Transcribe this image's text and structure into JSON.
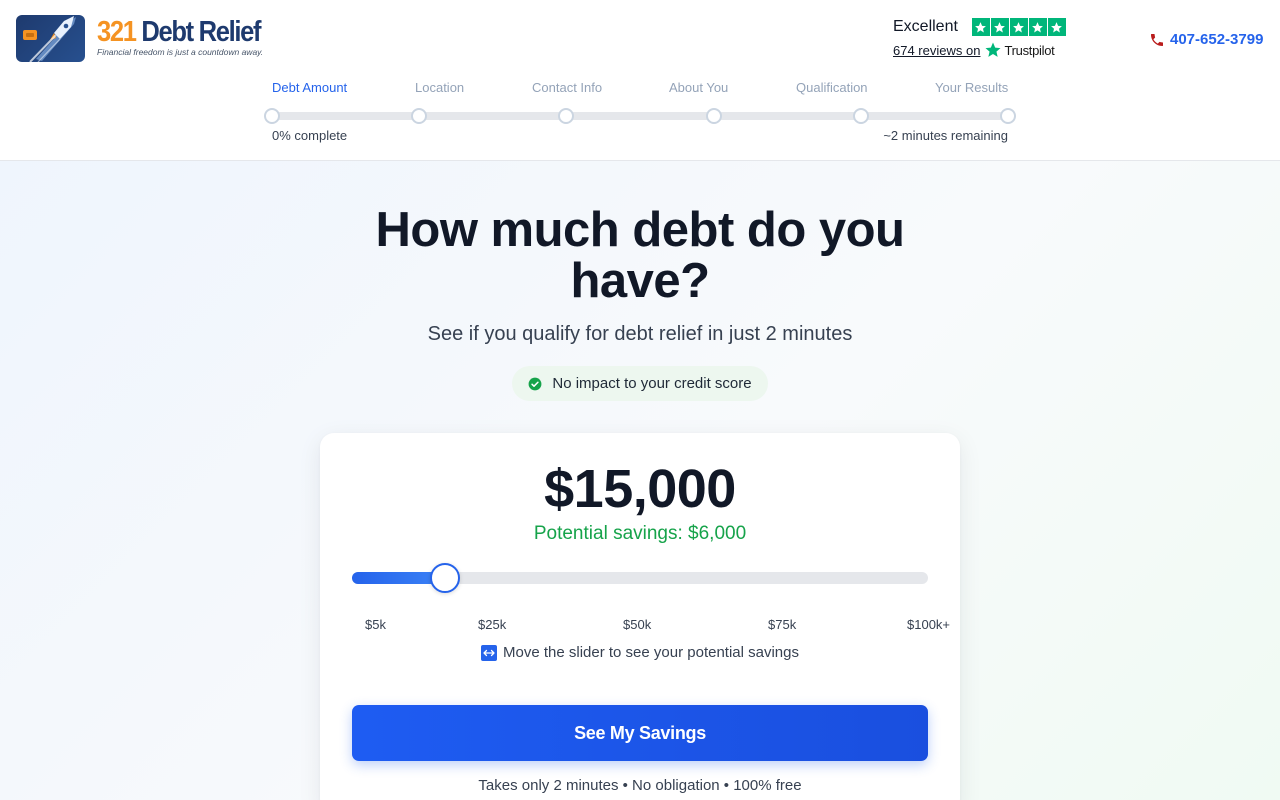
{
  "brand": {
    "name_number": "321",
    "name_words": "Debt Relief",
    "tagline": "Financial freedom is just a countdown away."
  },
  "trustpilot": {
    "rating_text": "Excellent",
    "stars": 5,
    "reviews_text": "674 reviews on",
    "platform": "Trustpilot",
    "color": "#00b67a"
  },
  "phone": {
    "number": "407-652-3799",
    "icon": "phone-icon"
  },
  "steps": {
    "items": [
      {
        "label": "Debt Amount",
        "active": true
      },
      {
        "label": "Location",
        "active": false
      },
      {
        "label": "Contact Info",
        "active": false
      },
      {
        "label": "About You",
        "active": false
      },
      {
        "label": "Qualification",
        "active": false
      },
      {
        "label": "Your Results",
        "active": false
      }
    ],
    "progress_percent": 0,
    "complete_text": "0% complete",
    "remaining_text": "~2 minutes remaining"
  },
  "hero": {
    "headline": "How much debt do you have?",
    "subheadline": "See if you qualify for debt relief in just 2 minutes",
    "badge_text": "No impact to your credit score"
  },
  "calculator": {
    "amount": "$15,000",
    "savings_text": "Potential savings: $6,000",
    "slider_value_fraction": 0.162,
    "tick_labels": [
      "$5k",
      "$25k",
      "$50k",
      "$75k",
      "$100k+"
    ],
    "hint_text": "Move the slider to see your potential savings",
    "cta_label": "See My Savings",
    "footnote": "Takes only 2 minutes • No obligation • 100% free"
  },
  "colors": {
    "accent": "#2563eb",
    "success": "#16a34a",
    "brand_orange": "#f59322",
    "brand_navy": "#1e3a6e"
  }
}
